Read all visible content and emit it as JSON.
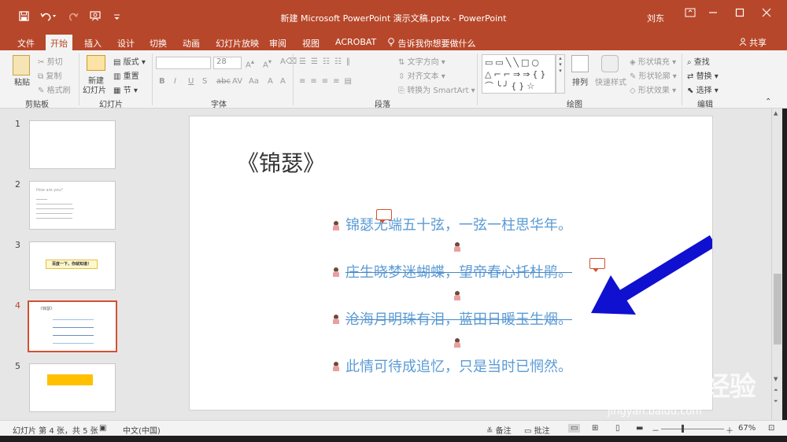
{
  "window": {
    "title": "新建 Microsoft PowerPoint 演示文稿.pptx  -  PowerPoint",
    "user": "刘东",
    "qat_icons": [
      "save-icon",
      "undo-icon",
      "redo-icon",
      "present-icon",
      "customize-icon"
    ],
    "window_controls": [
      "minimize-icon",
      "maximize-icon",
      "close-icon"
    ]
  },
  "tabs": {
    "items": [
      "文件",
      "开始",
      "插入",
      "设计",
      "切换",
      "动画",
      "幻灯片放映",
      "审阅",
      "视图",
      "ACROBAT"
    ],
    "active": "开始",
    "tell_me": "告诉我你想要做什么",
    "share": "共享"
  },
  "ribbon": {
    "clipboard": {
      "label": "剪贴板",
      "paste": "粘贴",
      "cut": "剪切",
      "copy": "复制",
      "format_painter": "格式刷"
    },
    "slides": {
      "label": "幻灯片",
      "new_slide": "新建",
      "new_slide2": "幻灯片",
      "layout": "版式",
      "reset": "重置",
      "section": "节"
    },
    "font": {
      "label": "字体",
      "font_name": "",
      "font_size": "28",
      "buttons": [
        "B",
        "I",
        "U",
        "S",
        "abc",
        "AV",
        "Aa",
        "A",
        "A"
      ]
    },
    "paragraph": {
      "label": "段落",
      "text_direction": "文字方向",
      "align_text": "对齐文本",
      "smartart": "转换为 SmartArt"
    },
    "drawing": {
      "label": "绘图",
      "arrange": "排列",
      "quick_styles": "快速样式",
      "shape_fill": "形状填充",
      "shape_outline": "形状轮廓",
      "shape_effects": "形状效果",
      "shapes_row1": "▭▭╲╲□○",
      "shapes_row2": "△⌐⌐⇒⇒{}",
      "shapes_row3": "⌒╰╯{}☆"
    },
    "editing": {
      "label": "编辑",
      "find": "查找",
      "replace": "替换",
      "select": "选择"
    }
  },
  "thumbnails": [
    {
      "num": "1"
    },
    {
      "num": "2",
      "title": "How are you？"
    },
    {
      "num": "3",
      "box": "百度一下，你就知道！"
    },
    {
      "num": "4",
      "title": "《锦瑟》"
    },
    {
      "num": "5",
      "bar": ""
    }
  ],
  "active_slide": 4,
  "slide": {
    "title": "《锦瑟》",
    "lines": [
      "锦瑟无端五十弦，一弦一柱思华年。",
      "庄生晓梦迷蝴蝶，望帝春心托杜鹃。",
      "沧海月明珠有泪，蓝田日暖玉生烟。",
      "此情可待成追忆，只是当时已惘然。"
    ]
  },
  "status": {
    "slide_info": "幻灯片 第 4 张，共 5 张",
    "language": "中文(中国)",
    "notes": "备注",
    "comments": "批注",
    "zoom": "67%",
    "minus": "－",
    "plus": "＋"
  },
  "watermark": {
    "logo": "Bai du 经验",
    "url": "jingyan.baidu.com"
  },
  "colors": {
    "brand": "#b7472a",
    "accent_line": "#5b9bd5",
    "arrow": "#1010d0",
    "active_thumb": "#d35230"
  }
}
